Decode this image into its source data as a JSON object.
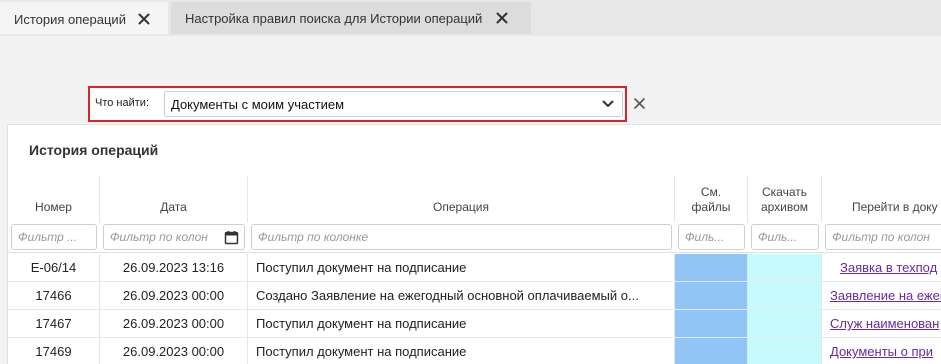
{
  "tabs": [
    {
      "label": "История операций",
      "active": true
    },
    {
      "label": "Настройка правил поиска для Истории операций",
      "active": false
    }
  ],
  "search": {
    "label": "Что найти:",
    "value": "Документы с моим участием"
  },
  "panel": {
    "title": "История операций"
  },
  "table": {
    "headers": {
      "num": "Номер",
      "date": "Дата",
      "op": "Операция",
      "files_l1": "См.",
      "files_l2": "файлы",
      "arch_l1": "Скачать",
      "arch_l2": "архивом",
      "link": "Перейти в доку"
    },
    "filters": {
      "num": "Фильтр ...",
      "date": "Фильтр по колон",
      "op": "Фильтр по колонке",
      "files": "Филь...",
      "arch": "Филь...",
      "link": "Фильтр по колон"
    },
    "rows": [
      {
        "num": "Е-06/14",
        "date": "26.09.2023 13:16",
        "op": "Поступил документ на подписание",
        "link": "Заявка в техпод"
      },
      {
        "num": "17466",
        "date": "26.09.2023 00:00",
        "op": "Создано Заявление на ежегодный основной оплачиваемый о...",
        "link": "Заявление на ежег"
      },
      {
        "num": "17467",
        "date": "26.09.2023 00:00",
        "op": "Поступил документ на подписание",
        "link": "Служ наименован"
      },
      {
        "num": "17469",
        "date": "26.09.2023 00:00",
        "op": "Поступил документ на подписание",
        "link": "Документы о при"
      }
    ]
  },
  "colors": {
    "highlight_border": "#d6252d",
    "files_cell": "#90c5f5",
    "archive_cell": "#c6fbfd",
    "link": "#6b2a9b"
  },
  "icons": {
    "tab_close": "close-icon",
    "dropdown": "chevron-down-icon",
    "clear": "close-icon",
    "date_filter": "calendar-icon"
  }
}
